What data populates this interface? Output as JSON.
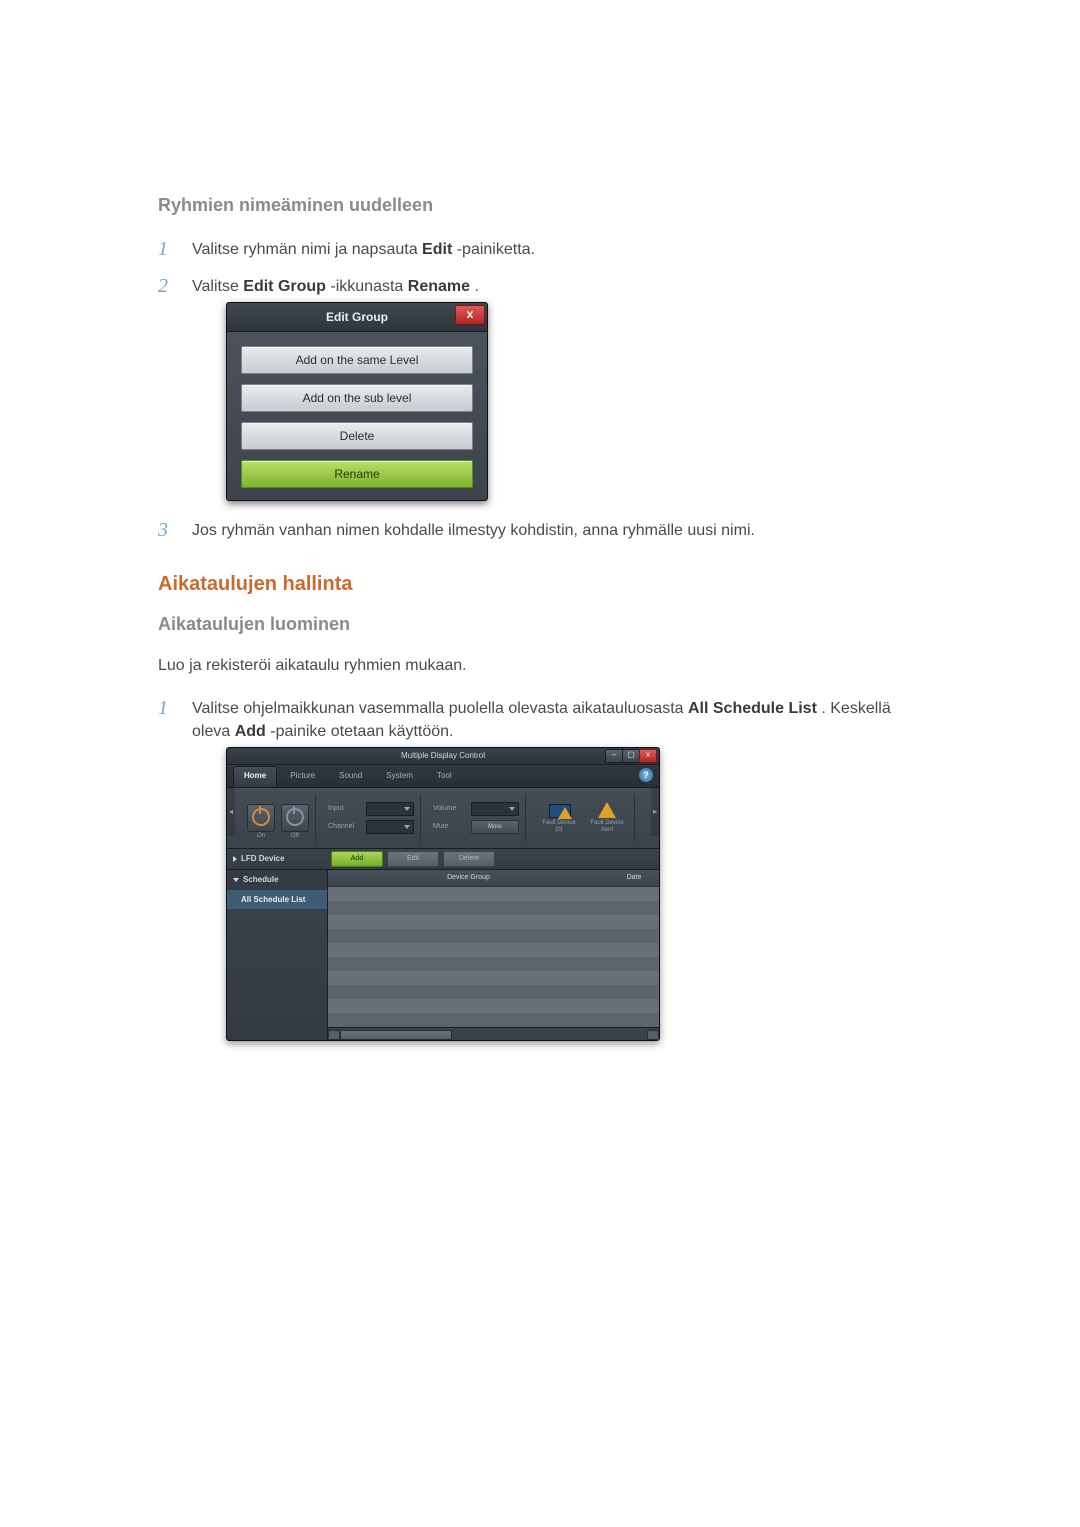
{
  "section1": {
    "heading": "Ryhmien nimeäminen uudelleen",
    "steps": [
      {
        "prefix": "Valitse ryhmän nimi ja napsauta ",
        "bold": "Edit",
        "suffix": "-painiketta."
      },
      {
        "prefix": "Valitse ",
        "bold": "Edit Group",
        "mid": " -ikkunasta ",
        "bold2": "Rename",
        "suffix": "."
      },
      {
        "prefix": "Jos ryhmän vanhan nimen kohdalle ilmestyy kohdistin, anna ryhmälle uusi nimi.",
        "bold": "",
        "suffix": ""
      }
    ]
  },
  "edit_group_dialog": {
    "title": "Edit Group",
    "close_glyph": "x",
    "buttons": [
      "Add on the same Level",
      "Add on the sub level",
      "Delete",
      "Rename"
    ]
  },
  "section2": {
    "heading": "Aikataulujen hallinta",
    "sub_heading": "Aikataulujen luominen",
    "body": "Luo ja rekisteröi aikataulu ryhmien mukaan.",
    "step1": {
      "prefix": "Valitse ohjelmaikkunan vasemmalla puolella olevasta aikatauluosasta ",
      "bold1": "All Schedule List",
      "mid": ". Keskellä oleva ",
      "bold2": "Add",
      "suffix": "-painike otetaan käyttöön."
    }
  },
  "mdc": {
    "title": "Multiple Display Control",
    "tabs": [
      "Home",
      "Picture",
      "Sound",
      "System",
      "Tool"
    ],
    "help_glyph": "?",
    "win": {
      "min": "–",
      "max": "▢",
      "close": "x"
    },
    "power": {
      "on": "On",
      "off": "Off"
    },
    "fields": {
      "input": "Input",
      "channel": "Channel",
      "volume": "Volume",
      "mute": "Mute",
      "more": "More"
    },
    "fault0": "Fault Device (0)",
    "fault_alert": "Fault Device Alert",
    "action_left": "LFD Device",
    "actions": {
      "add": "Add",
      "edit": "Edit",
      "delete": "Delete"
    },
    "side": {
      "header": "Schedule",
      "item": "All Schedule List"
    },
    "cols": {
      "group": "Device Group",
      "date": "Date"
    }
  }
}
